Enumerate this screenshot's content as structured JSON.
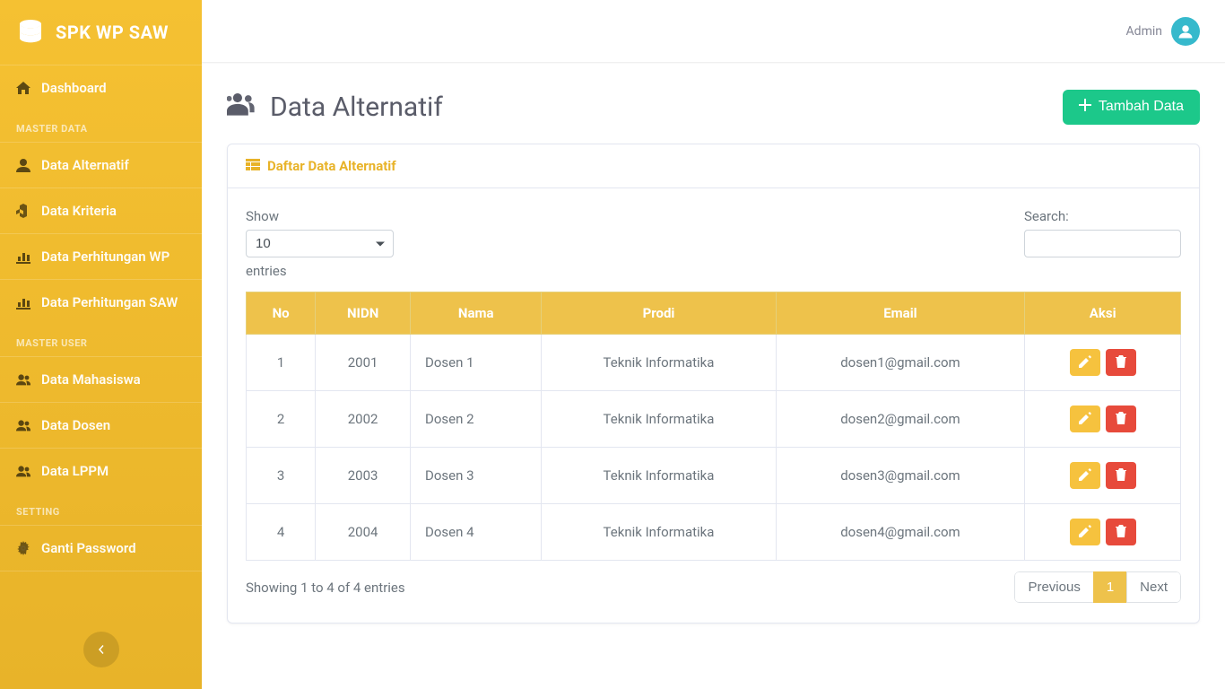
{
  "brand": {
    "title": "SPK WP SAW"
  },
  "topbar": {
    "username": "Admin"
  },
  "sidebar": {
    "sections": [
      {
        "heading": null,
        "items": [
          {
            "label": "Dashboard",
            "icon": "home"
          }
        ]
      },
      {
        "heading": "MASTER DATA",
        "items": [
          {
            "label": "Data Alternatif",
            "icon": "user"
          },
          {
            "label": "Data Kriteria",
            "icon": "cubes"
          },
          {
            "label": "Data Perhitungan WP",
            "icon": "chart"
          },
          {
            "label": "Data Perhitungan SAW",
            "icon": "chart"
          }
        ]
      },
      {
        "heading": "MASTER USER",
        "items": [
          {
            "label": "Data Mahasiswa",
            "icon": "users"
          },
          {
            "label": "Data Dosen",
            "icon": "users"
          },
          {
            "label": "Data LPPM",
            "icon": "users"
          }
        ]
      },
      {
        "heading": "SETTING",
        "items": [
          {
            "label": "Ganti Password",
            "icon": "cogs"
          }
        ]
      }
    ]
  },
  "page": {
    "title": "Data Alternatif",
    "add_button": "Tambah Data"
  },
  "card": {
    "title": "Daftar Data Alternatif"
  },
  "datatable": {
    "length_label_pre": "Show",
    "length_label_post": "entries",
    "length_value": "10",
    "search_label": "Search:",
    "columns": [
      "No",
      "NIDN",
      "Nama",
      "Prodi",
      "Email",
      "Aksi"
    ],
    "rows": [
      {
        "no": "1",
        "nidn": "2001",
        "nama": "Dosen 1",
        "prodi": "Teknik Informatika",
        "email": "dosen1@gmail.com"
      },
      {
        "no": "2",
        "nidn": "2002",
        "nama": "Dosen 2",
        "prodi": "Teknik Informatika",
        "email": "dosen2@gmail.com"
      },
      {
        "no": "3",
        "nidn": "2003",
        "nama": "Dosen 3",
        "prodi": "Teknik Informatika",
        "email": "dosen3@gmail.com"
      },
      {
        "no": "4",
        "nidn": "2004",
        "nama": "Dosen 4",
        "prodi": "Teknik Informatika",
        "email": "dosen4@gmail.com"
      }
    ],
    "info": "Showing 1 to 4 of 4 entries",
    "pagination": {
      "prev": "Previous",
      "next": "Next",
      "pages": [
        "1"
      ],
      "active": "1"
    }
  }
}
